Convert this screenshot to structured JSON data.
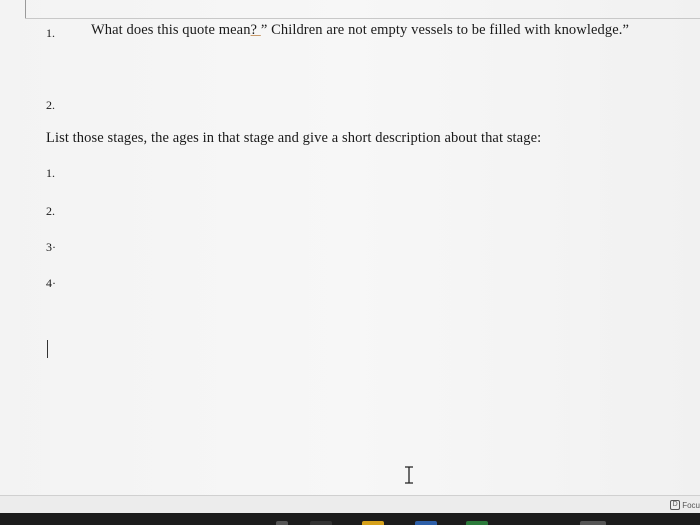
{
  "document": {
    "question1": {
      "number": "1.",
      "text_before": "What does this quote mean",
      "text_underlined": "? ",
      "text_after": "” Children are not empty vessels to be filled with knowledge.”"
    },
    "item2": {
      "number": "2."
    },
    "instruction": "List those stages, the ages in that stage and give a short description about that stage:",
    "stages": [
      {
        "number": "1."
      },
      {
        "number": "2."
      },
      {
        "number": "3·"
      },
      {
        "number": "4·"
      }
    ]
  },
  "status_bar": {
    "focus_label": "Focu",
    "focus_icon": "focus-mode-icon"
  },
  "colors": {
    "page": "#f5f5f5",
    "text": "#1a1a1a",
    "taskbar": "#1c1c1c"
  }
}
